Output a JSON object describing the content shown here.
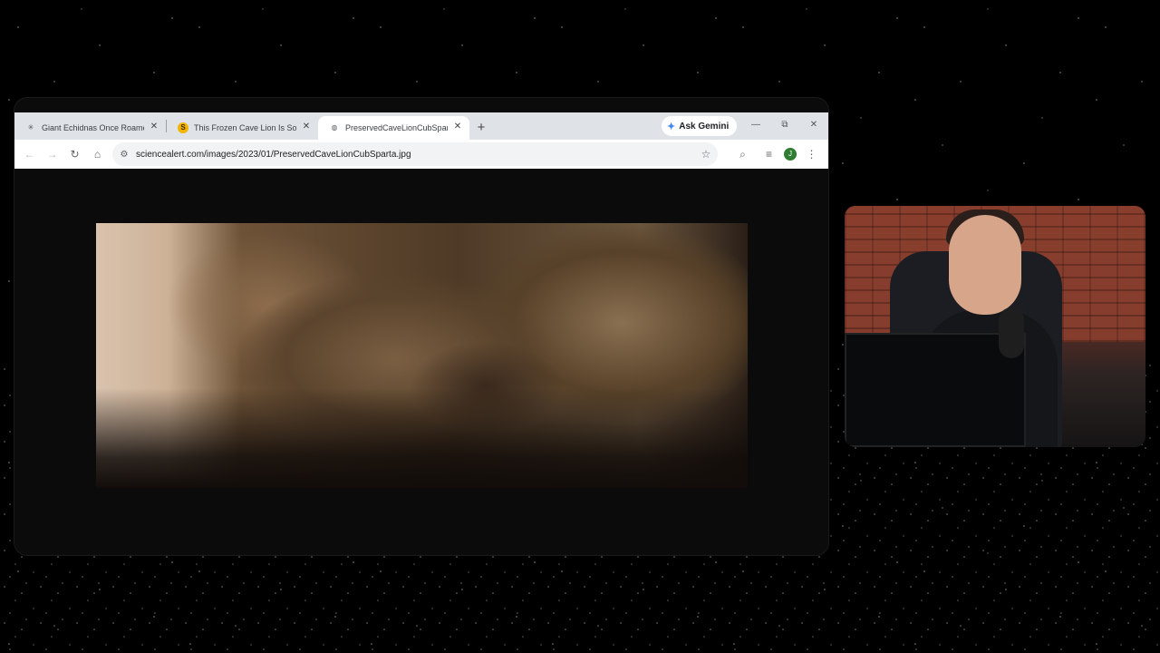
{
  "browser": {
    "tabs": [
      {
        "title": "Giant Echidnas Once Roamed A",
        "icon": "echidna-favicon",
        "active": false
      },
      {
        "title": "This Frozen Cave Lion Is So We",
        "icon": "s-favicon",
        "active": false
      },
      {
        "title": "PreservedCaveLionCubSparta.jp",
        "icon": "globe-favicon",
        "active": true
      }
    ],
    "new_tab": "+",
    "ask_gemini": "Ask Gemini",
    "window_controls": {
      "minimize": "—",
      "restore": "⧉",
      "close": "✕"
    },
    "toolbar": {
      "url": "sciencealert.com/images/2023/01/PreservedCaveLionCubSparta.jpg",
      "profile_initial": "J"
    }
  },
  "content": {
    "image_description_icon": "cave-lion-cub-photo"
  },
  "webcam": {
    "icon": "streamer-webcam-feed"
  }
}
